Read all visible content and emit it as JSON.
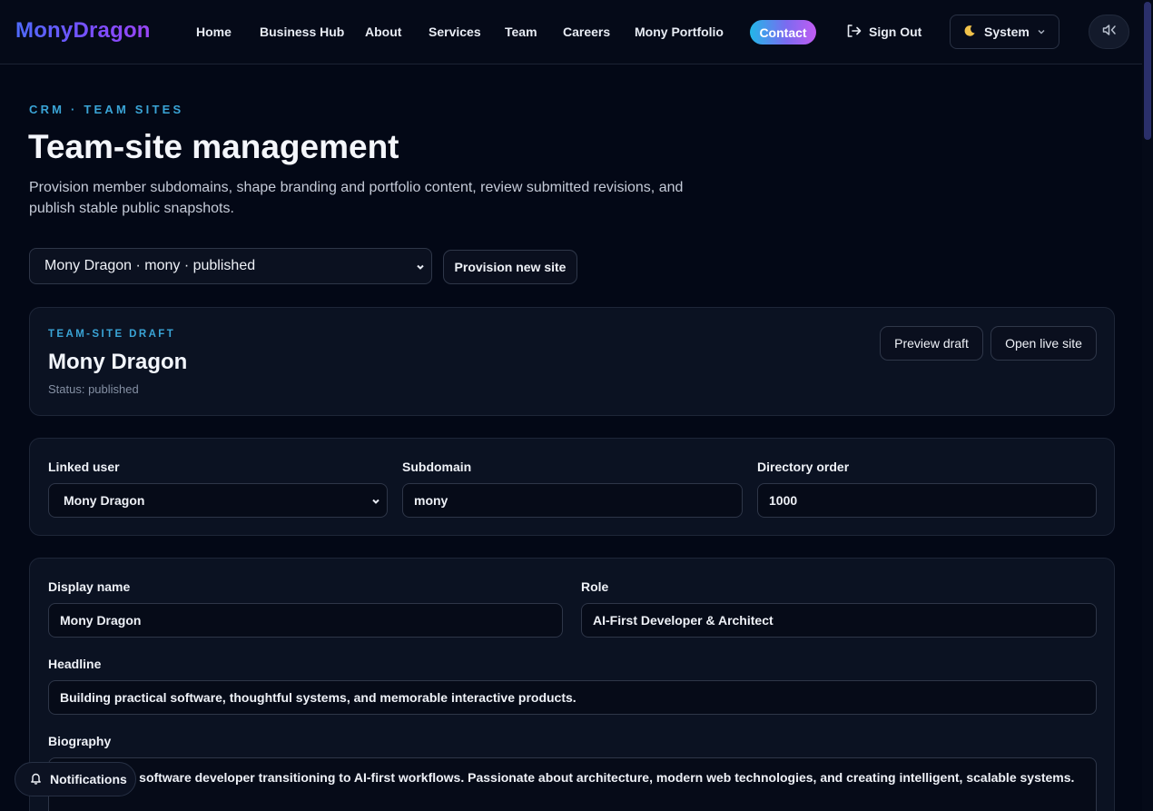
{
  "header": {
    "logo": "MonyDragon",
    "nav": [
      "Home",
      "Business Hub",
      "About",
      "Services",
      "Team",
      "Careers",
      "Mony Portfolio"
    ],
    "contact_label": "Contact",
    "signout_label": "Sign Out",
    "theme_label": "System",
    "theme_icon": "moon-icon",
    "sound_icon": "mute-icon"
  },
  "page": {
    "eyebrow": "CRM · TEAM SITES",
    "title": "Team-site management",
    "description": "Provision member subdomains, shape branding and portfolio content, review submitted revisions, and publish stable public snapshots."
  },
  "site_picker": {
    "selected": "Mony Dragon · mony · published",
    "provision_label": "Provision new site"
  },
  "draft_card": {
    "eyebrow": "TEAM-SITE DRAFT",
    "title": "Mony Dragon",
    "status": "Status: published",
    "preview_label": "Preview draft",
    "live_label": "Open live site"
  },
  "linkage": {
    "linked_user_label": "Linked user",
    "linked_user_value": "Mony Dragon",
    "subdomain_label": "Subdomain",
    "subdomain_value": "mony",
    "order_label": "Directory order",
    "order_value": "1000"
  },
  "profile": {
    "display_name_label": "Display name",
    "display_name_value": "Mony Dragon",
    "role_label": "Role",
    "role_value": "AI-First Developer & Architect",
    "headline_label": "Headline",
    "headline_value": "Building practical software, thoughtful systems, and memorable interactive products.",
    "bio_label": "Biography",
    "bio_value": "Experienced software developer transitioning to AI-first workflows. Passionate about architecture, modern web technologies, and creating intelligent, scalable systems."
  },
  "notifications": {
    "label": "Notifications"
  },
  "colors": {
    "accent": "#3aa4d6",
    "background": "#030816",
    "card": "#0b1222"
  }
}
